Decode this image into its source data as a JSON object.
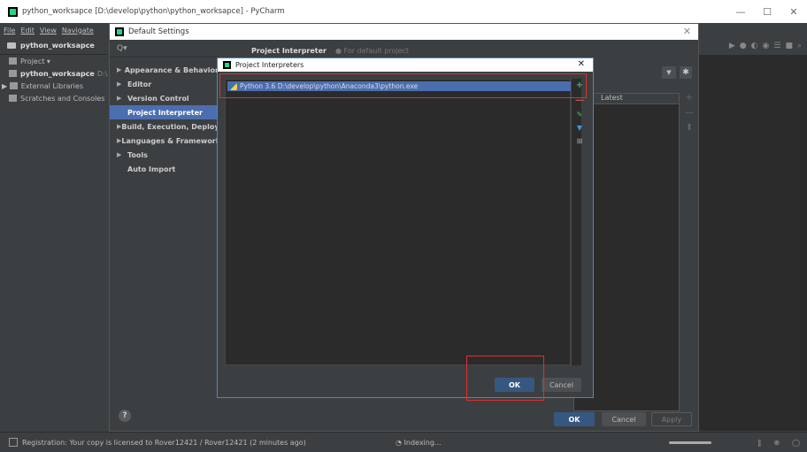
{
  "window": {
    "title": "python_worksapce [D:\\develop\\python\\python_worksapce] - PyCharm",
    "controls": [
      "—",
      "☐",
      "✕"
    ]
  },
  "menu": [
    "File",
    "Edit",
    "View",
    "Navigate"
  ],
  "project_toolbar": {
    "label": "python_worksapce"
  },
  "tree": {
    "head": "Project",
    "items": [
      {
        "label": "python_worksapce",
        "path": "D:\\"
      },
      {
        "label": "External Libraries"
      },
      {
        "label": "Scratches and Consoles"
      }
    ]
  },
  "settings": {
    "title": "Default Settings",
    "search_placeholder": "Q▾",
    "nav": [
      {
        "label": "Appearance & Behavior",
        "arrow": "▶"
      },
      {
        "label": "Editor",
        "arrow": "▶"
      },
      {
        "label": "Version Control",
        "arrow": "▶"
      },
      {
        "label": "Project Interpreter",
        "arrow": ""
      },
      {
        "label": "Build, Execution, Deployment",
        "arrow": "▶"
      },
      {
        "label": "Languages & Frameworks",
        "arrow": "▶"
      },
      {
        "label": "Tools",
        "arrow": "▶"
      },
      {
        "label": "Auto Import",
        "arrow": ""
      }
    ],
    "selected_nav": "Project Interpreter",
    "header_title": "Project Interpreter",
    "header_sub": "For default project",
    "table_header": "Latest",
    "help": "?",
    "ok_label": "OK",
    "cancel_label": "Cancel",
    "apply_label": "Apply"
  },
  "interpreters_dialog": {
    "title": "Project Interpreters",
    "items": [
      "Python 3.6 D:\\develop\\python\\Anaconda3\\python.exe"
    ],
    "ok_label": "OK",
    "cancel_label": "Cancel"
  },
  "status": {
    "registration": "Registration: Your copy is licensed to Rover12421 / Rover12421 (2 minutes ago)",
    "indexing": "Indexing..."
  },
  "colors": {
    "selection": "#4b6eaf",
    "primary_button": "#365880",
    "highlight": "#e03030",
    "add": "#59a869",
    "remove": "#c75450"
  }
}
